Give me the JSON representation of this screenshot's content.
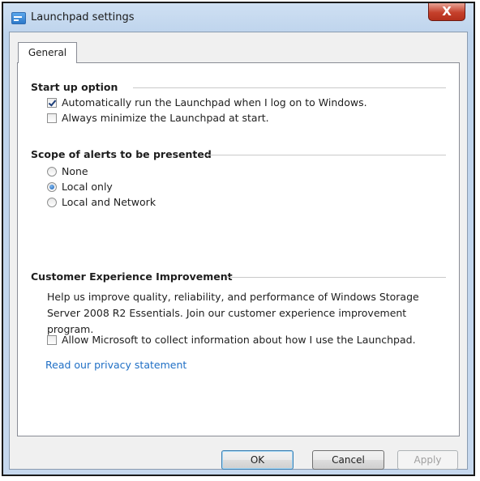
{
  "window": {
    "title": "Launchpad settings",
    "close_label": "X"
  },
  "tabs": [
    {
      "label": "General"
    }
  ],
  "startup": {
    "header": "Start up option",
    "options": [
      {
        "label": "Automatically run the Launchpad when I log on to Windows.",
        "checked": true
      },
      {
        "label": "Always minimize the Launchpad at start.",
        "checked": false
      }
    ]
  },
  "alerts": {
    "header": "Scope of alerts to be presented",
    "options": [
      {
        "label": "None",
        "selected": false
      },
      {
        "label": "Local only",
        "selected": true
      },
      {
        "label": "Local and Network",
        "selected": false
      }
    ]
  },
  "ceip": {
    "header": "Customer Experience Improvement",
    "description": "Help us improve quality, reliability, and performance of Windows Storage Server 2008 R2 Essentials. Join our customer experience improvement program.",
    "checkbox_label": "Allow Microsoft to collect information about how I use the Launchpad.",
    "checkbox_checked": false,
    "link_text": "Read our privacy statement"
  },
  "buttons": {
    "ok": "OK",
    "cancel": "Cancel",
    "apply": "Apply"
  },
  "colors": {
    "link": "#1f6fc5",
    "close_button": "#c5402b",
    "frame": "#bdd3ec"
  }
}
